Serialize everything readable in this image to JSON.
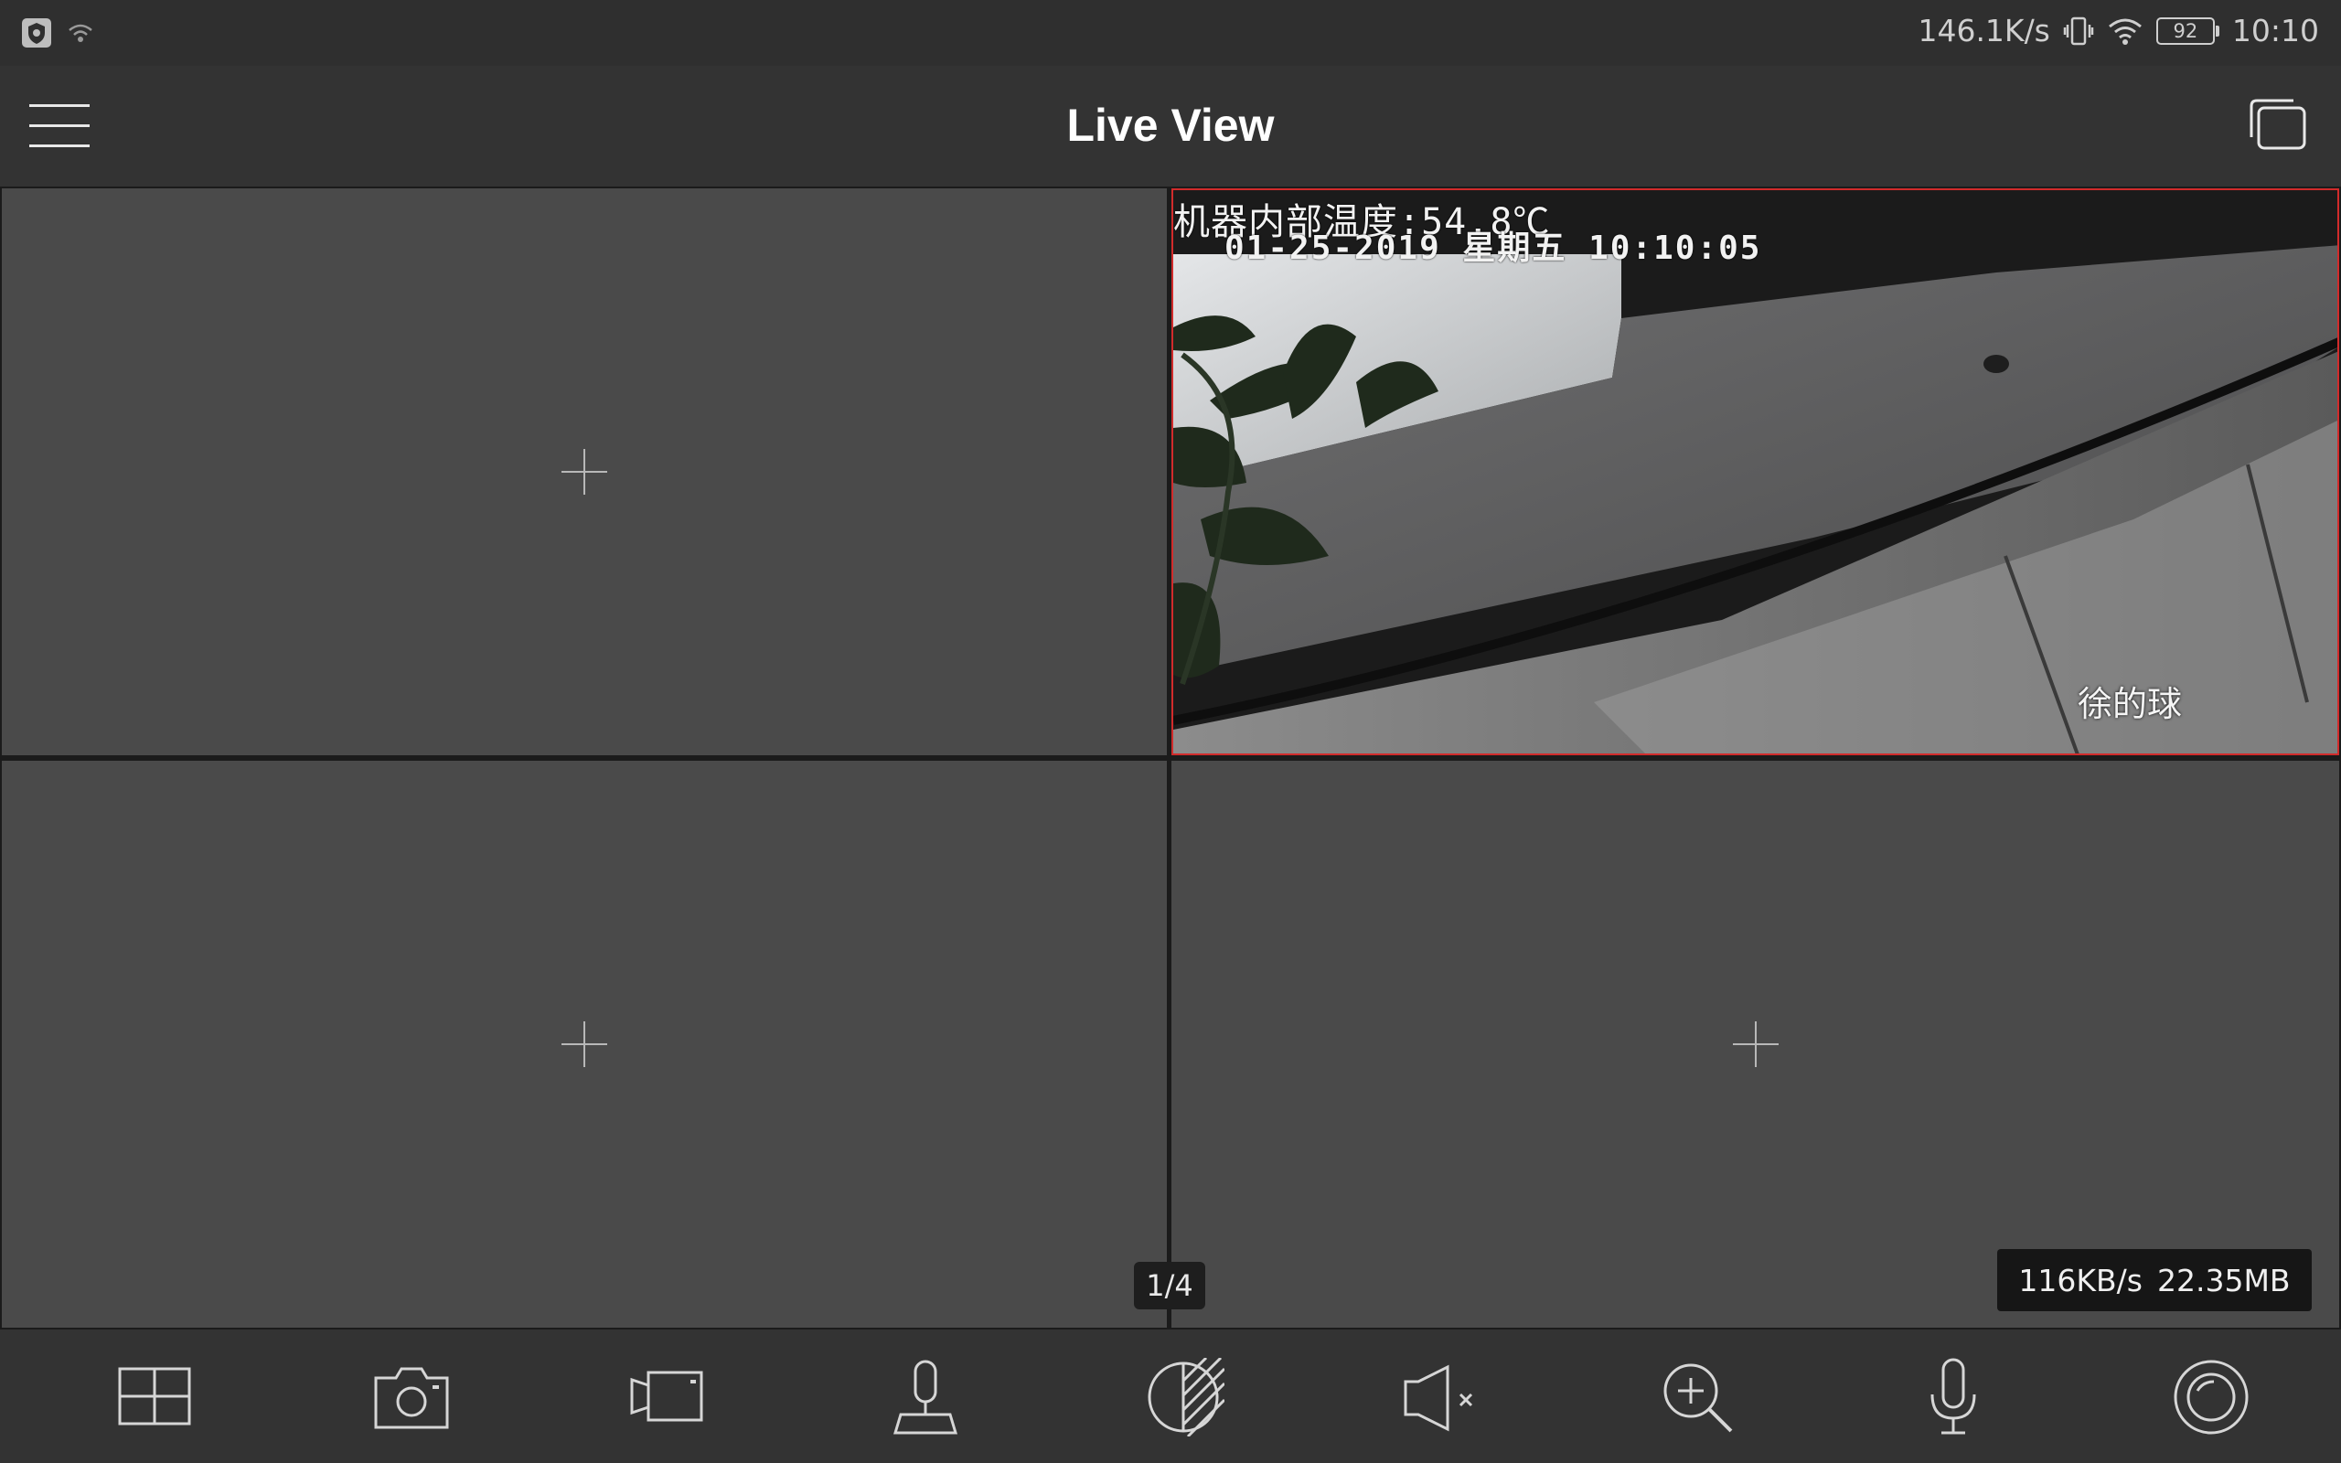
{
  "status_bar": {
    "network_speed": "146.1K/s",
    "battery_level": "92",
    "time": "10:10",
    "icons": [
      "shield-app-icon",
      "wifi-hotspot-icon",
      "vibrate-icon",
      "wifi-icon",
      "battery-icon"
    ]
  },
  "app_bar": {
    "title": "Live View",
    "icons": [
      "hamburger-menu-icon",
      "window-switch-icon"
    ]
  },
  "live_view": {
    "selected_pane": 2,
    "panes": [
      {
        "position": 1,
        "state": "empty",
        "icon": "add-channel-icon"
      },
      {
        "position": 2,
        "state": "playing",
        "osd_line1": "机器内部温度:54.8℃",
        "osd_line2": "01-25-2019 星期五 10:10:05",
        "camera_name": "徐的球"
      },
      {
        "position": 3,
        "state": "empty",
        "icon": "add-channel-icon"
      },
      {
        "position": 4,
        "state": "empty",
        "icon": "add-channel-icon"
      }
    ],
    "page_indicator": "1/4",
    "stream_rate": "116KB/s",
    "data_total": "22.35MB",
    "accent_color": "#d12b2b"
  },
  "toolbar": {
    "items": [
      "layout-grid-icon",
      "snapshot-camera-icon",
      "record-video-icon",
      "ptz-joystick-icon",
      "image-quality-icon",
      "audio-mute-icon",
      "digital-zoom-icon",
      "two-way-talk-microphone-icon",
      "fisheye-icon"
    ]
  }
}
